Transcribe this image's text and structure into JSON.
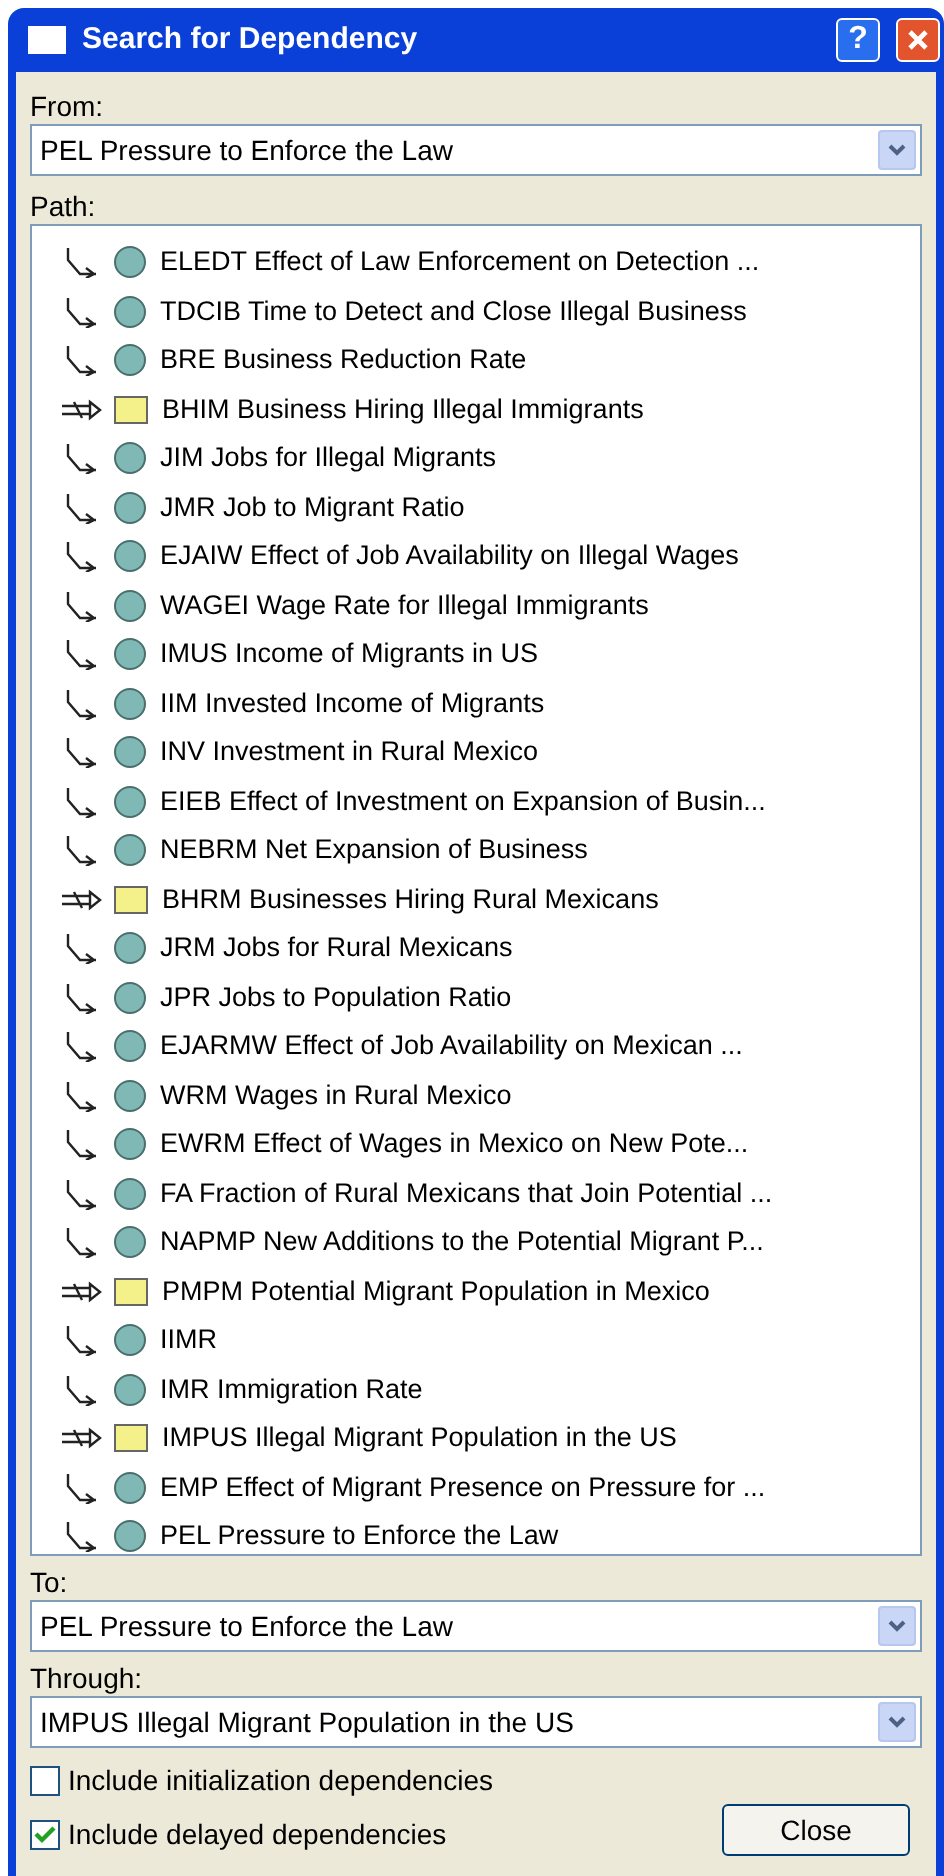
{
  "window": {
    "title": "Search for Dependency",
    "help_button": "?"
  },
  "from": {
    "label": "From:",
    "value": "PEL Pressure to Enforce the Law"
  },
  "path": {
    "label": "Path:",
    "items": [
      {
        "kind": "aux",
        "text": "ELEDT Effect of Law Enforcement on Detection ..."
      },
      {
        "kind": "aux",
        "text": "TDCIB Time to Detect and Close Illegal Business"
      },
      {
        "kind": "aux",
        "text": "BRE Business Reduction Rate"
      },
      {
        "kind": "level",
        "text": "BHIM Business Hiring Illegal Immigrants"
      },
      {
        "kind": "aux",
        "text": "JIM Jobs for Illegal Migrants"
      },
      {
        "kind": "aux",
        "text": "JMR Job to Migrant Ratio"
      },
      {
        "kind": "aux",
        "text": "EJAIW Effect of Job Availability on Illegal Wages"
      },
      {
        "kind": "aux",
        "text": "WAGEI Wage Rate for Illegal Immigrants"
      },
      {
        "kind": "aux",
        "text": "IMUS Income of Migrants in US"
      },
      {
        "kind": "aux",
        "text": "IIM Invested Income of Migrants"
      },
      {
        "kind": "aux",
        "text": "INV Investment in Rural Mexico"
      },
      {
        "kind": "aux",
        "text": "EIEB Effect of Investment on Expansion of Busin..."
      },
      {
        "kind": "aux",
        "text": "NEBRM Net Expansion of Business"
      },
      {
        "kind": "level",
        "text": "BHRM Businesses Hiring Rural Mexicans"
      },
      {
        "kind": "aux",
        "text": "JRM Jobs for Rural Mexicans"
      },
      {
        "kind": "aux",
        "text": "JPR Jobs to Population Ratio"
      },
      {
        "kind": "aux",
        "text": "EJARMW Effect of Job Availability on Mexican ..."
      },
      {
        "kind": "aux",
        "text": "WRM Wages in Rural Mexico"
      },
      {
        "kind": "aux",
        "text": "EWRM Effect of Wages in Mexico on New Pote..."
      },
      {
        "kind": "aux",
        "text": "FA Fraction of Rural Mexicans that Join Potential ..."
      },
      {
        "kind": "aux",
        "text": "NAPMP New Additions to the Potential Migrant P..."
      },
      {
        "kind": "level",
        "text": "PMPM Potential Migrant Population in Mexico"
      },
      {
        "kind": "aux",
        "text": "IIMR"
      },
      {
        "kind": "aux",
        "text": "IMR Immigration Rate"
      },
      {
        "kind": "level",
        "text": "IMPUS Illegal Migrant Population in the US"
      },
      {
        "kind": "aux",
        "text": "EMP Effect of Migrant Presence on Pressure for ..."
      },
      {
        "kind": "aux",
        "text": "PEL Pressure to Enforce the Law"
      }
    ]
  },
  "to": {
    "label": "To:",
    "value": "PEL Pressure to Enforce the Law"
  },
  "through": {
    "label": "Through:",
    "value": "IMPUS Illegal Migrant Population in the US"
  },
  "options": [
    {
      "label": "Include initialization dependencies",
      "checked": false
    },
    {
      "label": "Include delayed dependencies",
      "checked": true
    }
  ],
  "close_button": "Close"
}
